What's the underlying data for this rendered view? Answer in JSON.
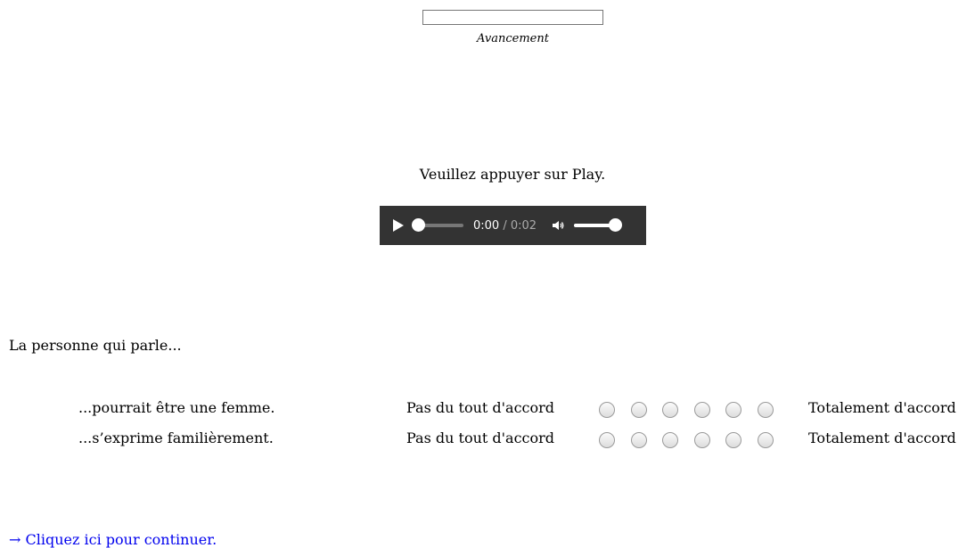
{
  "progress": {
    "label": "Avancement",
    "value": 0
  },
  "instruction": "Veuillez appuyer sur Play.",
  "audio": {
    "current_time": "0:00",
    "total_time": "/ 0:02",
    "position_fraction": 0,
    "volume_fraction": 1
  },
  "question": {
    "intro": "La personne qui parle...",
    "items": [
      {
        "statement": "...pourrait être une femme.",
        "left_anchor": "Pas du tout d'accord",
        "right_anchor": "Totalement d'accord",
        "scale_points": 6
      },
      {
        "statement": "...s’exprime familièrement.",
        "left_anchor": "Pas du tout d'accord",
        "right_anchor": "Totalement d'accord",
        "scale_points": 6
      }
    ]
  },
  "continue_link": "→ Cliquez ici pour continuer."
}
